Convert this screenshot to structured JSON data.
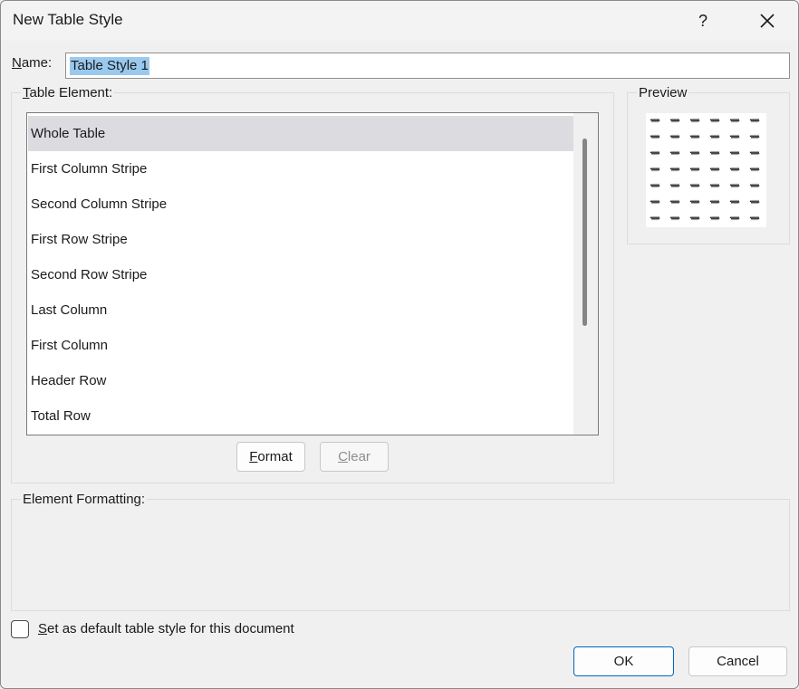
{
  "window": {
    "title": "New Table Style",
    "help_glyph": "?",
    "close_glyph": "✕"
  },
  "name_field": {
    "label_accel": "N",
    "label_rest": "ame:",
    "value": "Table Style 1"
  },
  "table_element": {
    "label_accel": "T",
    "label_rest": "able Element:",
    "items": [
      {
        "label": "Whole Table",
        "selected": true
      },
      {
        "label": "First Column Stripe",
        "selected": false
      },
      {
        "label": "Second Column Stripe",
        "selected": false
      },
      {
        "label": "First Row Stripe",
        "selected": false
      },
      {
        "label": "Second Row Stripe",
        "selected": false
      },
      {
        "label": "Last Column",
        "selected": false
      },
      {
        "label": "First Column",
        "selected": false
      },
      {
        "label": "Header Row",
        "selected": false
      },
      {
        "label": "Total Row",
        "selected": false
      }
    ],
    "format_accel": "F",
    "format_rest": "ormat",
    "clear_accel": "C",
    "clear_rest": "lear"
  },
  "preview": {
    "label": "Preview",
    "rows": 7,
    "cols": 6
  },
  "element_formatting": {
    "label": "Element Formatting:"
  },
  "default_checkbox": {
    "label_accel": "S",
    "label_rest": "et as default table style for this document",
    "checked": false
  },
  "footer": {
    "ok_label": "OK",
    "cancel_label": "Cancel"
  },
  "colors": {
    "selection_highlight": "#99c9ef",
    "selected_item": "#dcdce0",
    "default_button_border": "#0067c0"
  }
}
